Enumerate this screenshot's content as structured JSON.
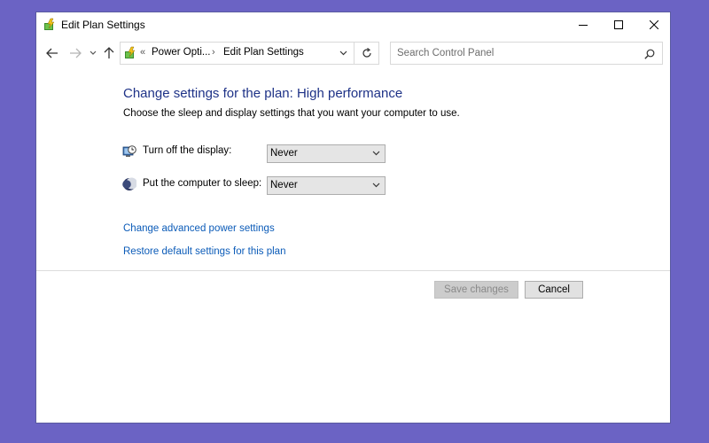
{
  "window": {
    "title": "Edit Plan Settings"
  },
  "address_bar": {
    "overflow": "«",
    "crumbs": [
      "Power Opti...",
      "Edit Plan Settings"
    ],
    "separator": "›"
  },
  "search": {
    "placeholder": "Search Control Panel"
  },
  "content": {
    "heading": "Change settings for the plan: High performance",
    "subtext": "Choose the sleep and display settings that you want your computer to use.",
    "display_row": {
      "label": "Turn off the display:",
      "value": "Never"
    },
    "sleep_row": {
      "label": "Put the computer to sleep:",
      "value": "Never"
    },
    "links": {
      "advanced": "Change advanced power settings",
      "restore": "Restore default settings for this plan"
    }
  },
  "buttons": {
    "save": "Save changes",
    "cancel": "Cancel"
  },
  "colors": {
    "background": "#6b63c4",
    "heading": "#1e3287",
    "link": "#0b5bb8"
  },
  "icons": {
    "app": "power-options-icon",
    "display": "monitor-clock-icon",
    "sleep": "moon-icon"
  }
}
